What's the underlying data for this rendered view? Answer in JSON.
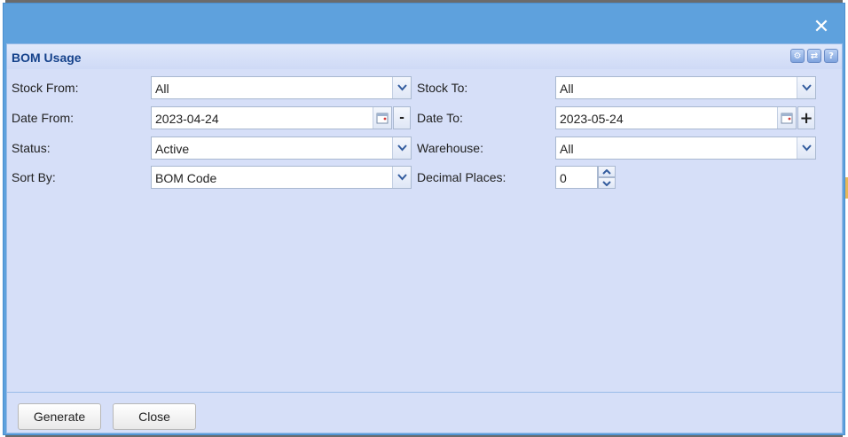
{
  "dialog": {
    "close_glyph": "✕",
    "title": "BOM Usage",
    "tools": [
      "gear-icon",
      "refresh-icon",
      "help-icon"
    ]
  },
  "form": {
    "stock_from_label": "Stock From:",
    "stock_from_value": "All",
    "stock_to_label": "Stock To:",
    "stock_to_value": "All",
    "date_from_label": "Date From:",
    "date_from_value": "2023-04-24",
    "date_from_step": "-",
    "date_to_label": "Date To:",
    "date_to_value": "2023-05-24",
    "date_to_step": "+",
    "status_label": "Status:",
    "status_value": "Active",
    "warehouse_label": "Warehouse:",
    "warehouse_value": "All",
    "sort_by_label": "Sort By:",
    "sort_by_value": "BOM Code",
    "decimal_places_label": "Decimal Places:",
    "decimal_places_value": "0"
  },
  "footer": {
    "generate_label": "Generate",
    "close_label": "Close"
  },
  "colors": {
    "titlebar": "#5ea1dd",
    "panel": "#d6dff8",
    "title_text": "#15428b"
  }
}
